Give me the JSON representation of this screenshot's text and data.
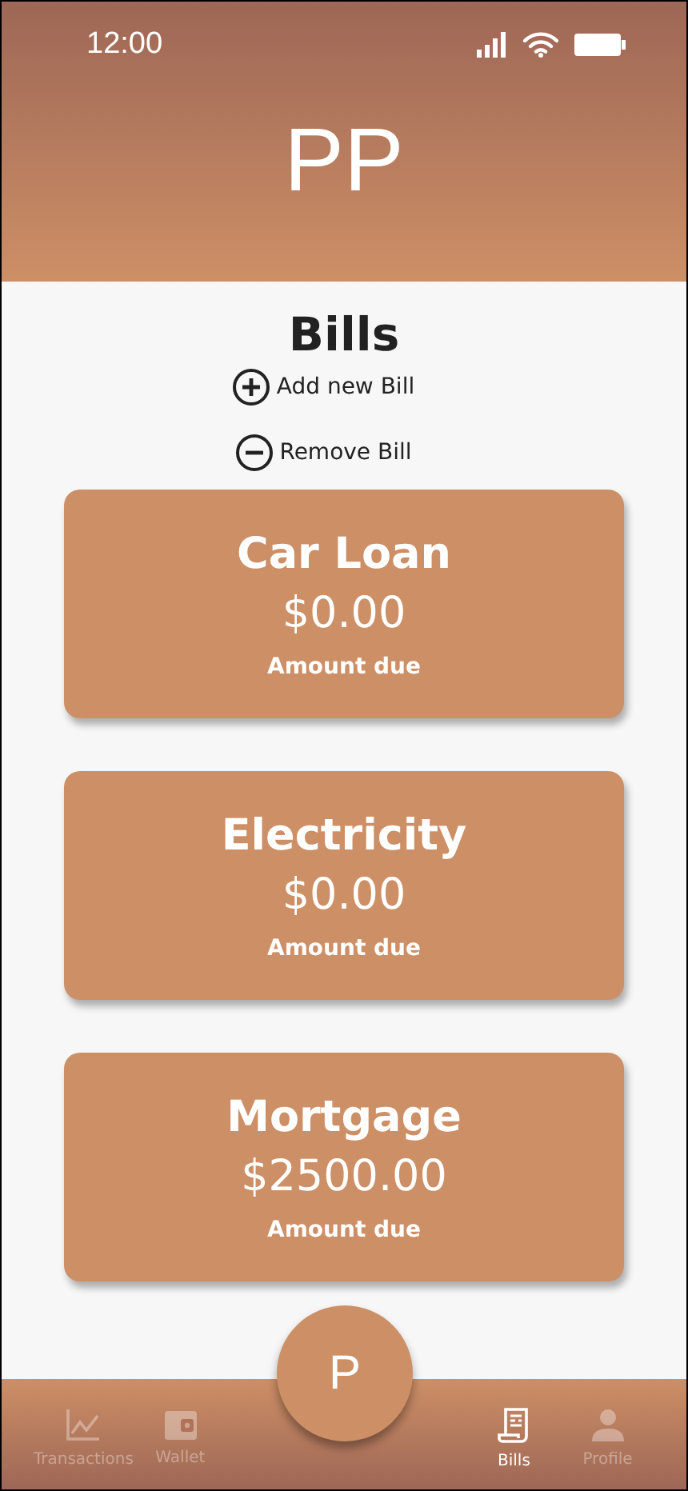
{
  "status_bar": {
    "time": "12:00"
  },
  "header": {
    "title": "PP"
  },
  "page": {
    "title": "Bills"
  },
  "actions": [
    {
      "kind": "add",
      "label": "Add new Bill"
    },
    {
      "kind": "remove",
      "label": "Remove Bill"
    }
  ],
  "bills": [
    {
      "name": "Car Loan",
      "amount": "$0.00",
      "caption": "Amount due"
    },
    {
      "name": "Electricity",
      "amount": "$0.00",
      "caption": "Amount due"
    },
    {
      "name": "Mortgage",
      "amount": "$2500.00",
      "caption": "Amount due"
    }
  ],
  "fab": {
    "label": "P"
  },
  "nav": [
    {
      "kind": "chart",
      "label": "Transactions",
      "selected": false
    },
    {
      "kind": "wallet",
      "label": "Wallet",
      "selected": false
    },
    {
      "kind": "receipt",
      "label": "Bills",
      "selected": true
    },
    {
      "kind": "person",
      "label": "Profile",
      "selected": false
    }
  ]
}
